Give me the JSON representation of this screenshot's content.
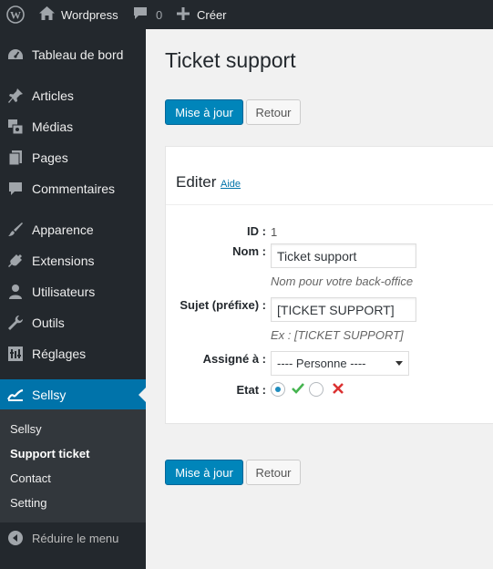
{
  "adminbar": {
    "site_name": "Wordpress",
    "comments_count": "0",
    "new_label": "Créer"
  },
  "sidebar": {
    "items": [
      {
        "label": "Tableau de bord",
        "icon": "dashboard-icon"
      },
      {
        "label": "Articles",
        "icon": "pin-icon"
      },
      {
        "label": "Médias",
        "icon": "media-icon"
      },
      {
        "label": "Pages",
        "icon": "pages-icon"
      },
      {
        "label": "Commentaires",
        "icon": "comment-icon"
      },
      {
        "label": "Apparence",
        "icon": "brush-icon"
      },
      {
        "label": "Extensions",
        "icon": "plugin-icon"
      },
      {
        "label": "Utilisateurs",
        "icon": "user-icon"
      },
      {
        "label": "Outils",
        "icon": "wrench-icon"
      },
      {
        "label": "Réglages",
        "icon": "settings-icon"
      },
      {
        "label": "Sellsy",
        "icon": "chart-icon"
      }
    ],
    "submenu": [
      "Sellsy",
      "Support ticket",
      "Contact",
      "Setting"
    ],
    "collapse_label": "Réduire le menu"
  },
  "main": {
    "title": "Ticket support",
    "update_label": "Mise à jour",
    "back_label": "Retour",
    "panel": {
      "title": "Editer",
      "help_label": "Aide"
    },
    "form": {
      "id_label": "ID :",
      "id_value": "1",
      "name_label": "Nom :",
      "name_value": "Ticket support",
      "name_hint": "Nom pour votre back-office",
      "subject_label": "Sujet (préfixe) :",
      "subject_value": "[TICKET SUPPORT]",
      "subject_hint": "Ex : [TICKET SUPPORT]",
      "assigned_label": "Assigné à :",
      "assigned_value": "---- Personne ----",
      "state_label": "Etat :"
    }
  },
  "colors": {
    "primary": "#0085ba",
    "sidebar_bg": "#23282d",
    "current_menu": "#0073aa",
    "check_green": "#46b450",
    "cross_red": "#dc3232"
  }
}
